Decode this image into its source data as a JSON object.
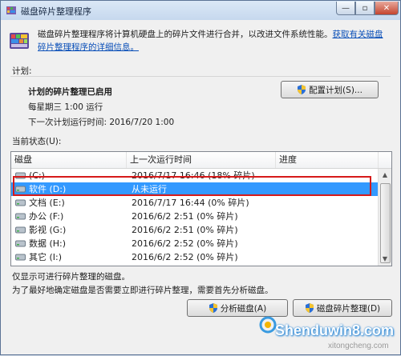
{
  "window": {
    "title": "磁盘碎片整理程序"
  },
  "controls": {
    "minimize": "—",
    "maximize": "▫",
    "close": "✕"
  },
  "intro": {
    "text": "磁盘碎片整理程序将计算机硬盘上的碎片文件进行合并，以改进文件系统性能。",
    "link": "获取有关磁盘碎片整理程序的详细信息。"
  },
  "schedule": {
    "section_label": "计划:",
    "status": "计划的碎片整理已启用",
    "frequency": "每星期三 1:00 运行",
    "next_run": "下一次计划运行时间: 2016/7/20 1:00",
    "configure_button": "配置计划(S)..."
  },
  "current_status": {
    "section_label": "当前状态(U):",
    "columns": [
      "磁盘",
      "上一次运行时间",
      "进度"
    ],
    "rows": [
      {
        "disk": "(C:)",
        "last_run": "2016/7/17 16:46 (18% 碎片)",
        "progress": ""
      },
      {
        "disk": "软件 (D:)",
        "last_run": "从未运行",
        "progress": ""
      },
      {
        "disk": "文档 (E:)",
        "last_run": "2016/7/17 16:44 (0% 碎片)",
        "progress": ""
      },
      {
        "disk": "办公 (F:)",
        "last_run": "2016/6/2 2:51 (0% 碎片)",
        "progress": ""
      },
      {
        "disk": "影视 (G:)",
        "last_run": "2016/6/2 2:51 (0% 碎片)",
        "progress": ""
      },
      {
        "disk": "数据 (H:)",
        "last_run": "2016/6/2 2:52 (0% 碎片)",
        "progress": ""
      },
      {
        "disk": "其它 (I:)",
        "last_run": "2016/6/2 2:52 (0% 碎片)",
        "progress": ""
      }
    ],
    "selected_index": 1
  },
  "notes": {
    "line1": "仅显示可进行碎片整理的磁盘。",
    "line2": "为了最好地确定磁盘是否需要立即进行碎片整理，需要首先分析磁盘。"
  },
  "actions": {
    "analyze_button": "分析磁盘(A)",
    "defrag_button": "磁盘碎片整理(D)"
  },
  "watermark": {
    "site": "Shenduwin8.com",
    "sub": "xitongcheng.com"
  },
  "colors": {
    "selection": "#3399ff",
    "highlight_border": "#d61a1a",
    "link": "#0a4fb8"
  }
}
